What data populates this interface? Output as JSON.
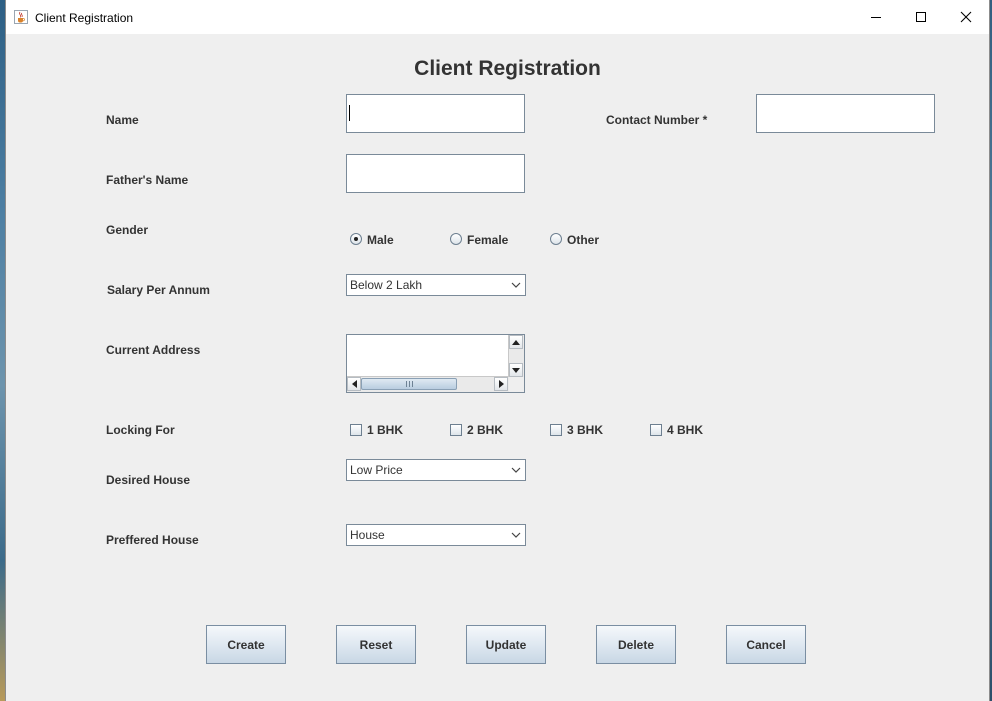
{
  "window": {
    "title": "Client Registration"
  },
  "form": {
    "heading": "Client Registration",
    "name": {
      "label": "Name",
      "value": ""
    },
    "contact": {
      "label": "Contact Number *",
      "value": ""
    },
    "father_name": {
      "label": "Father's Name",
      "value": ""
    },
    "gender": {
      "label": "Gender",
      "options": [
        "Male",
        "Female",
        "Other"
      ],
      "selected": "Male"
    },
    "salary": {
      "label": "Salary Per Annum",
      "selected": "Below 2 Lakh"
    },
    "address": {
      "label": "Current Address",
      "value": ""
    },
    "looking_for": {
      "label": "Locking For",
      "options": [
        "1 BHK",
        "2 BHK",
        "3 BHK",
        "4 BHK"
      ],
      "checked": []
    },
    "desired_house": {
      "label": "Desired House",
      "selected": "Low Price"
    },
    "preferred_house": {
      "label": "Preffered House",
      "selected": "House"
    }
  },
  "buttons": {
    "create": "Create",
    "reset": "Reset",
    "update": "Update",
    "delete": "Delete",
    "cancel": "Cancel"
  },
  "icons": {
    "app": "java-cup-icon",
    "minimize": "minimize-icon",
    "maximize": "maximize-icon",
    "close": "close-icon"
  }
}
